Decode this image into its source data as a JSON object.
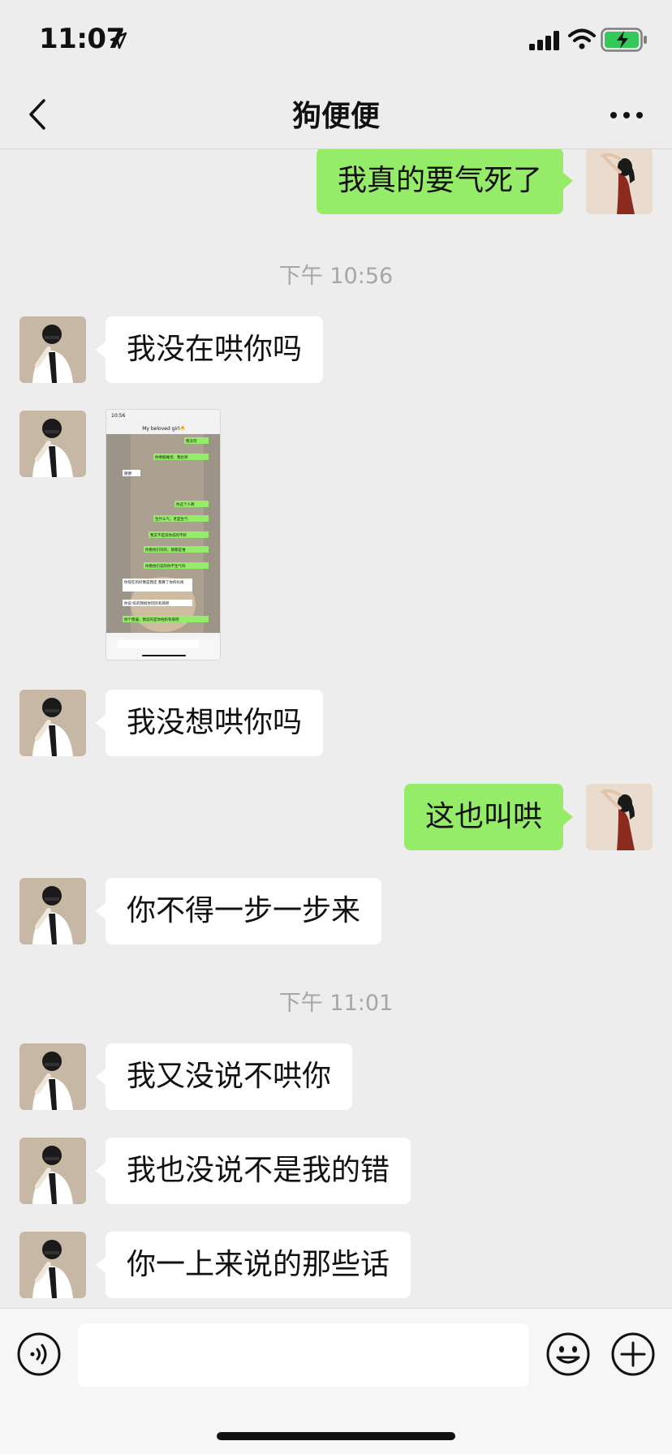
{
  "status_bar": {
    "time": "11:07"
  },
  "nav": {
    "title": "狗便便"
  },
  "messages": [
    {
      "side": "right",
      "text": "我真的要气死了"
    },
    {
      "timestamp": "下午 10:56"
    },
    {
      "side": "left",
      "text": "我没在哄你吗"
    },
    {
      "side": "left",
      "image": "screenshot-of-chat"
    },
    {
      "side": "left",
      "text": "我没想哄你吗"
    },
    {
      "side": "right",
      "text": "这也叫哄"
    },
    {
      "side": "left",
      "text": "你不得一步一步来"
    },
    {
      "timestamp": "下午 11:01"
    },
    {
      "side": "left",
      "text": "我又没说不哄你"
    },
    {
      "side": "left",
      "text": "我也没说不是我的错"
    },
    {
      "side": "left",
      "text": "你一上来说的那些话"
    }
  ],
  "shared_image": {
    "time": "10:56",
    "title": "My beloved girl🐣",
    "bubbles": [
      {
        "side": "right",
        "text": "我没玩"
      },
      {
        "side": "right",
        "text": "你要能睡觉，我也哭"
      },
      {
        "side": "left",
        "text": "随便"
      },
      {
        "side": "right",
        "text": "你这个人啊"
      },
      {
        "side": "right",
        "text": "生什么气，老是生气"
      },
      {
        "side": "right",
        "text": "我又不是说你说的不好"
      },
      {
        "side": "right",
        "text": "你看他们玩的，那都是谁"
      },
      {
        "side": "right",
        "text": "你看他们说的你不生气吗"
      },
      {
        "side": "left",
        "text": "你现在的好像是我还 我算了你的抖视"
      },
      {
        "side": "left",
        "text": "你说 吼的我搞你玩的有病吧"
      },
      {
        "side": "right",
        "text": "你个傻逼，我说的是你他妈有病吧"
      }
    ]
  },
  "colors": {
    "background": "#ededed",
    "bubble_right": "#95ec69",
    "bubble_left": "#ffffff",
    "timestamp": "#a6a6a6"
  }
}
